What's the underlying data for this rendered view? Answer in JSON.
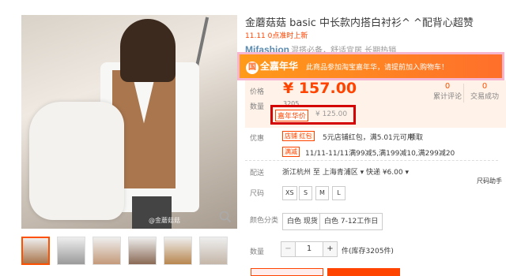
{
  "product": {
    "title": "金蘑菇菇 basic 中长款内搭白衬衫^ ^配背心超赞",
    "subtitle": "11.11 0点准时上新",
    "brand_logo": "Mifashion",
    "brand_text": "混搭必备，舒适宜居 长期热销"
  },
  "gallery": {
    "watermark": "@金蘑菇菇",
    "thumbnails": [
      {
        "bg": "#a9764e"
      },
      {
        "bg": "#9a9a9a"
      },
      {
        "bg": "#c49a7a"
      },
      {
        "bg": "#8a6a55"
      },
      {
        "bg": "#b8864f"
      },
      {
        "bg": "#c4b6a8"
      }
    ]
  },
  "promo": {
    "logo_char": "国",
    "logo_text": "全嘉年华",
    "message": "此商品参加淘宝嘉年华，请提前加入购物车！"
  },
  "pricing": {
    "price_label": "价格",
    "price": "¥ 157.00",
    "sold_label": "数量",
    "sold_value": "3205",
    "reviews_count": "0",
    "reviews_label": "累计评论",
    "trades_count": "0",
    "trades_label": "交易成功",
    "festival_tag": "嘉年华价",
    "festival_price": "¥ 125.00"
  },
  "offers": {
    "label": "优惠",
    "coupon1_tag": "店铺  红包",
    "coupon1_text": "5元店铺红包，满5.01元可用",
    "coupon1_link": "领取",
    "coupon2_tag": "满减",
    "coupon2_text": "11/11-11/11满99减5,满199减10,满299减20"
  },
  "shipping": {
    "label": "配送",
    "text": "浙江杭州 至 上海青浦区 ▾  快递 ¥6.00 ▾"
  },
  "sizes": {
    "label": "尺码",
    "options": [
      "XS",
      "S",
      "M",
      "L"
    ],
    "helper": "尺码助手"
  },
  "colors": {
    "label": "颜色分类",
    "options": [
      "白色 现货",
      "白色 7-12工作日"
    ]
  },
  "quantity": {
    "label": "数量",
    "minus": "−",
    "value": "1",
    "plus": "+",
    "stock": "件(库存3205件)"
  }
}
